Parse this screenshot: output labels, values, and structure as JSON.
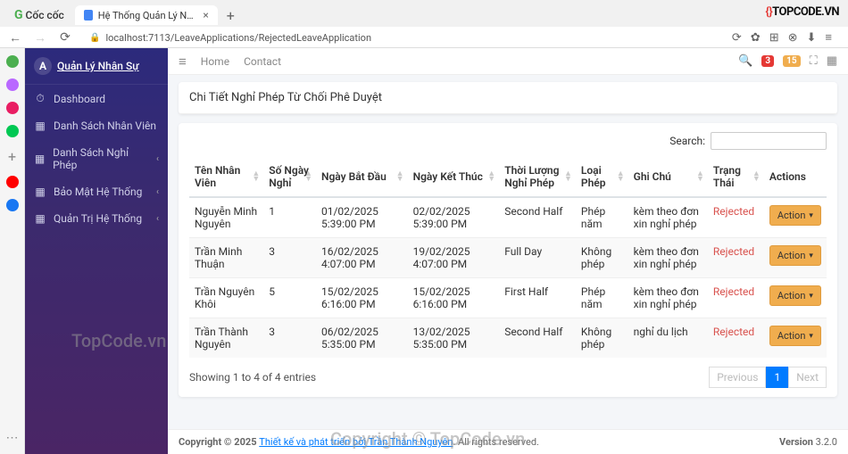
{
  "browser": {
    "brand": "Cốc cốc",
    "tab_title": "Hệ Thống Quản Lý Nhân Sự",
    "url": "localhost:7113/LeaveApplications/RejectedLeaveApplication",
    "topcode": "TOPCODE.VN"
  },
  "sidebar": {
    "title": "Quản Lý Nhân Sự",
    "items": [
      {
        "icon": "⏱",
        "label": "Dashboard",
        "chev": false
      },
      {
        "icon": "▦",
        "label": "Danh Sách Nhân Viên",
        "chev": false
      },
      {
        "icon": "▦",
        "label": "Danh Sách Nghỉ Phép",
        "chev": true
      },
      {
        "icon": "▦",
        "label": "Bảo Mật Hệ Thống",
        "chev": true
      },
      {
        "icon": "▦",
        "label": "Quản Trị Hệ Thống",
        "chev": true
      }
    ]
  },
  "topbar": {
    "home": "Home",
    "contact": "Contact",
    "badge1": "3",
    "badge2": "15"
  },
  "page": {
    "title": "Chi Tiết Nghỉ Phép Từ Chối Phê Duyệt",
    "search_label": "Search:",
    "columns": [
      "Tên Nhân Viên",
      "Số Ngày Nghỉ",
      "Ngày Bắt Đầu",
      "Ngày Kết Thúc",
      "Thời Lượng Nghỉ Phép",
      "Loại Phép",
      "Ghi Chú",
      "Trạng Thái",
      "Actions"
    ],
    "rows": [
      {
        "name": "Nguyễn Minh Nguyên",
        "days": "1",
        "start": "01/02/2025 5:39:00 PM",
        "end": "02/02/2025 5:39:00 PM",
        "duration": "Second Half",
        "type": "Phép năm",
        "note": "kèm theo đơn xin nghỉ phép",
        "status": "Rejected"
      },
      {
        "name": "Trần Minh Thuận",
        "days": "3",
        "start": "16/02/2025 4:07:00 PM",
        "end": "19/02/2025 4:07:00 PM",
        "duration": "Full Day",
        "type": "Không phép",
        "note": "kèm theo đơn xin nghỉ phép",
        "status": "Rejected"
      },
      {
        "name": "Trần Nguyên Khôi",
        "days": "5",
        "start": "15/02/2025 6:16:00 PM",
        "end": "15/02/2025 6:16:00 PM",
        "duration": "First Half",
        "type": "Phép năm",
        "note": "kèm theo đơn xin nghỉ phép",
        "status": "Rejected"
      },
      {
        "name": "Trần Thành Nguyên",
        "days": "3",
        "start": "06/02/2025 5:35:00 PM",
        "end": "13/02/2025 5:35:00 PM",
        "duration": "Second Half",
        "type": "Không phép",
        "note": "nghỉ du lịch",
        "status": "Rejected"
      }
    ],
    "action_label": "Action",
    "entries_info": "Showing 1 to 4 of 4 entries",
    "previous": "Previous",
    "page1": "1",
    "next": "Next"
  },
  "footer": {
    "copyright": "Copyright © 2025 ",
    "link": "Thiết kế và phát triển bởi Trần Thành Nguyên",
    "rights": ". All rights reserved.",
    "version_label": "Version",
    "version": "3.2.0"
  },
  "watermark": "TopCode.vn",
  "watermark2": "Copyright © TopCode.vn"
}
